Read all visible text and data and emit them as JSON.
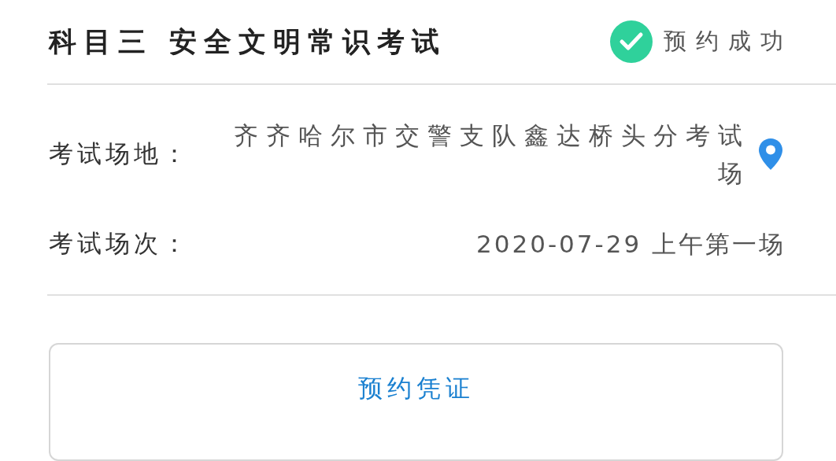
{
  "exam": {
    "title": "科目三 安全文明常识考试",
    "status": "预约成功",
    "confirmed": true
  },
  "details": [
    {
      "label": "考试场地：",
      "value": "齐齐哈尔市交警支队鑫达桥头分考试场",
      "kind": "location"
    },
    {
      "label": "考试场次：",
      "value": "2020-07-29 上午第一场",
      "kind": "text"
    }
  ],
  "button": {
    "label": "预约凭证"
  }
}
